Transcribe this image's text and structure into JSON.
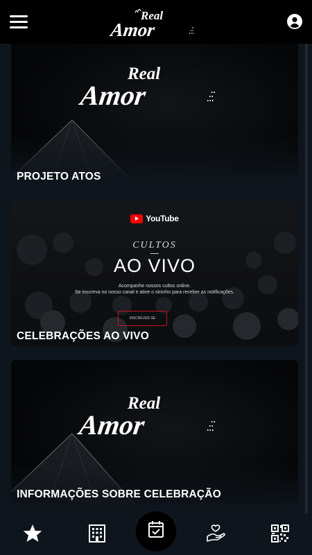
{
  "header": {
    "menu_icon": "hamburger-menu-icon",
    "logo_icon": "real-amor-logo",
    "logo_text": "Real Amor",
    "account_icon": "user-account-icon"
  },
  "cards": [
    {
      "title": "PROJETO ATOS",
      "logo_text": "Real Amor"
    },
    {
      "title": "CELEBRAÇÕES AO VIVO",
      "youtube_label": "YouTube",
      "cultos": "CULTOS",
      "ao_vivo": "AO VIVO",
      "line1": "Acompanhe nossos cultos online.",
      "line2": "Se inscreva no nosso canal e ative o sininho para receber as notificações.",
      "subscribe": "INSCREVER-SE"
    },
    {
      "title": "INFORMAÇÕES SOBRE CELEBRAÇÃO",
      "logo_text": "Real Amor"
    }
  ],
  "bottom_nav": {
    "items": [
      "star-icon",
      "building-icon",
      "calendar-check-icon",
      "heart-hand-icon",
      "qr-code-icon"
    ],
    "active": "calendar-check-icon"
  },
  "colors": {
    "background": "#000000",
    "content_bg": "#0f151c",
    "accent_red": "#ff0000"
  }
}
